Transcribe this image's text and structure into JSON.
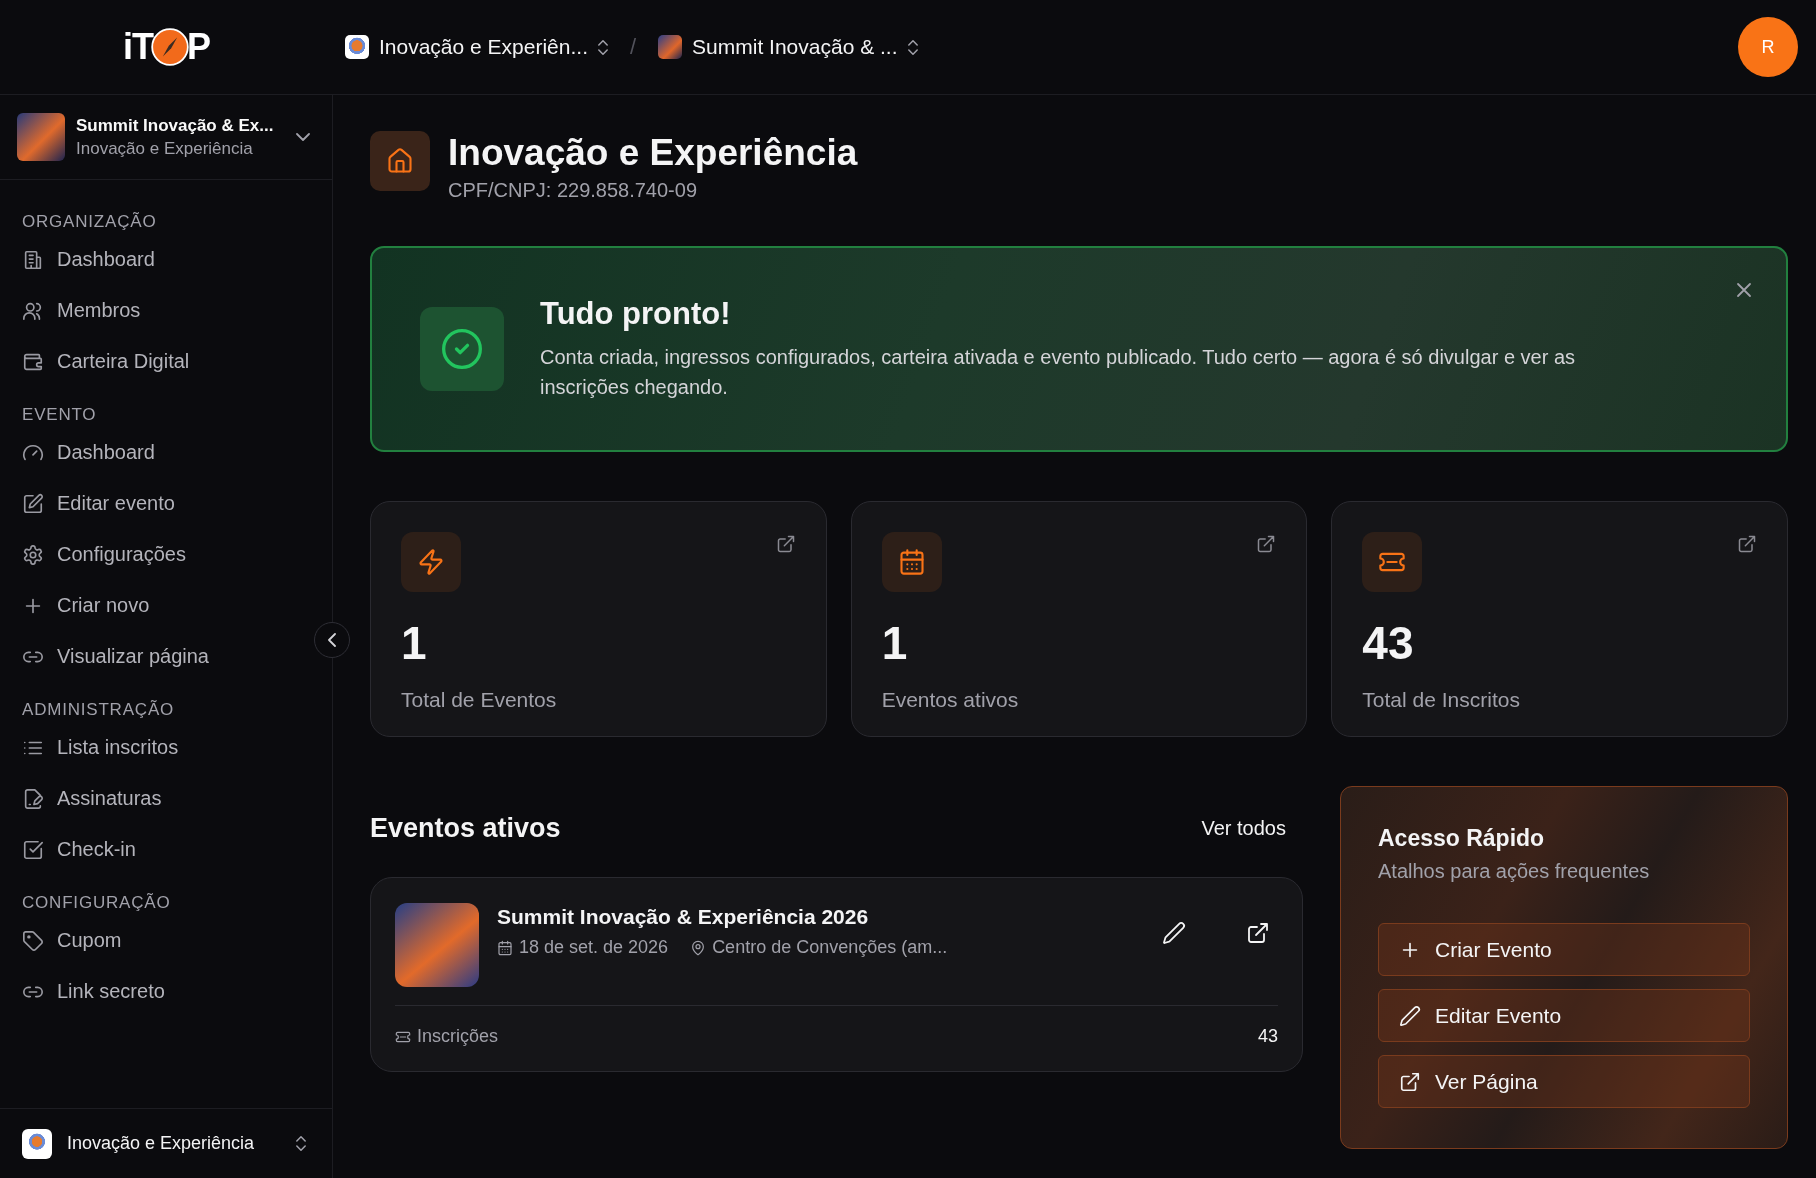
{
  "logo": {
    "prefix": "iT",
    "suffix": "P"
  },
  "breadcrumb": [
    {
      "label": "Inovação e Experiên...",
      "kind": "org"
    },
    {
      "label": "Summit Inovação & ...",
      "kind": "event"
    }
  ],
  "breadcrumb_separator": "/",
  "avatar": "R",
  "sidebar": {
    "event_switcher": {
      "title": "Summit Inovação & Ex...",
      "subtitle": "Inovação e Experiência"
    },
    "sections": [
      {
        "title": "ORGANIZAÇÃO",
        "items": [
          {
            "label": "Dashboard",
            "kind": "building"
          },
          {
            "label": "Membros",
            "kind": "users"
          },
          {
            "label": "Carteira Digital",
            "kind": "wallet"
          }
        ]
      },
      {
        "title": "EVENTO",
        "items": [
          {
            "label": "Dashboard",
            "kind": "gauge"
          },
          {
            "label": "Editar evento",
            "kind": "edit"
          },
          {
            "label": "Configurações",
            "kind": "gear"
          },
          {
            "label": "Criar novo",
            "kind": "plus"
          },
          {
            "label": "Visualizar página",
            "kind": "link"
          }
        ]
      },
      {
        "title": "ADMINISTRAÇÃO",
        "items": [
          {
            "label": "Lista inscritos",
            "kind": "list"
          },
          {
            "label": "Assinaturas",
            "kind": "sign"
          },
          {
            "label": "Check-in",
            "kind": "check"
          }
        ]
      },
      {
        "title": "CONFIGURAÇÃO",
        "items": [
          {
            "label": "Cupom",
            "kind": "tag"
          },
          {
            "label": "Link secreto",
            "kind": "link"
          }
        ]
      }
    ],
    "org_switcher": {
      "label": "Inovação e Experiência"
    }
  },
  "header": {
    "title": "Inovação e Experiência",
    "subtitle": "CPF/CNPJ: 229.858.740-09"
  },
  "banner": {
    "title": "Tudo pronto!",
    "text": "Conta criada, ingressos configurados, carteira ativada e evento publicado. Tudo certo — agora é só divulgar e ver as inscrições chegando."
  },
  "stats": [
    {
      "value": "1",
      "label": "Total de Eventos",
      "kind": "bolt"
    },
    {
      "value": "1",
      "label": "Eventos ativos",
      "kind": "calendar"
    },
    {
      "value": "43",
      "label": "Total de Inscritos",
      "kind": "ticket"
    }
  ],
  "active_events": {
    "title": "Eventos ativos",
    "link": "Ver todos",
    "events": [
      {
        "name": "Summit Inovação & Experiência 2026",
        "date": "18 de set. de 2026",
        "venue": "Centro de Convenções (am...",
        "footer_label": "Inscrições",
        "footer_value": "43"
      }
    ]
  },
  "quick_access": {
    "title": "Acesso Rápido",
    "subtitle": "Atalhos para ações frequentes",
    "actions": [
      {
        "label": "Criar Evento",
        "kind": "plus"
      },
      {
        "label": "Editar Evento",
        "kind": "pencil"
      },
      {
        "label": "Ver Página",
        "kind": "external"
      }
    ]
  }
}
